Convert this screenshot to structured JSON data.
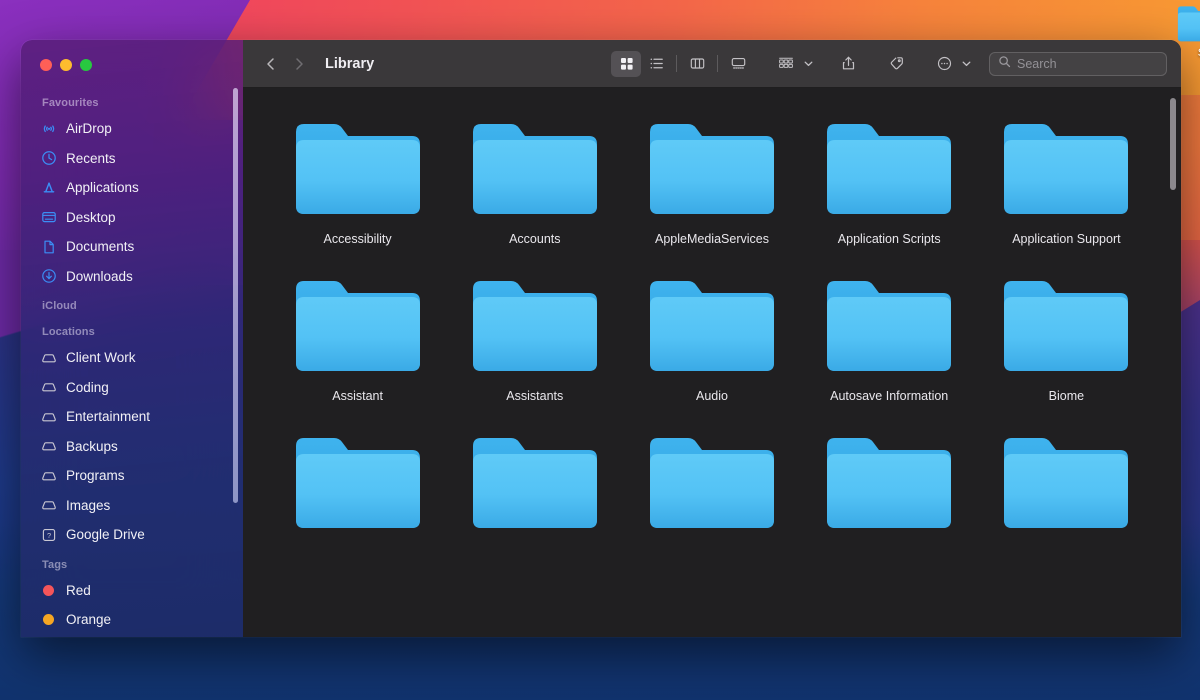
{
  "desktop": {
    "background_colors": {
      "purple": "#7d2bb0",
      "red": "#f0445f",
      "orange": "#f7873a",
      "blue": "#1e3a8a"
    },
    "items": [
      {
        "name": "Scr",
        "label": "Scr",
        "icon": "folder-icon"
      }
    ]
  },
  "window": {
    "title": "Library",
    "traffic_lights": {
      "close": "#ff5f57",
      "minimize": "#febc2e",
      "maximize": "#28c840"
    }
  },
  "toolbar": {
    "back_label": "‹",
    "forward_label": "›",
    "title": "Library",
    "view_modes": [
      {
        "name": "icon-view",
        "label": "Icon view",
        "active": true
      },
      {
        "name": "list-view",
        "label": "List view",
        "active": false
      },
      {
        "name": "column-view",
        "label": "Column view",
        "active": false
      },
      {
        "name": "gallery-view",
        "label": "Gallery view",
        "active": false
      }
    ],
    "group_label": "Group",
    "share_label": "Share",
    "tag_label": "Tags",
    "more_label": "More"
  },
  "search": {
    "placeholder": "Search",
    "value": ""
  },
  "sidebar": {
    "sections": [
      {
        "title": "Favourites",
        "items": [
          {
            "label": "AirDrop",
            "icon": "airdrop-icon"
          },
          {
            "label": "Recents",
            "icon": "clock-icon"
          },
          {
            "label": "Applications",
            "icon": "appstore-icon"
          },
          {
            "label": "Desktop",
            "icon": "desktop-icon"
          },
          {
            "label": "Documents",
            "icon": "document-icon"
          },
          {
            "label": "Downloads",
            "icon": "download-icon"
          }
        ]
      },
      {
        "title": "iCloud",
        "items": []
      },
      {
        "title": "Locations",
        "items": [
          {
            "label": "Client Work",
            "icon": "drive-icon"
          },
          {
            "label": "Coding",
            "icon": "drive-icon"
          },
          {
            "label": "Entertainment",
            "icon": "drive-icon"
          },
          {
            "label": "Backups",
            "icon": "drive-icon"
          },
          {
            "label": "Programs",
            "icon": "drive-icon"
          },
          {
            "label": "Images",
            "icon": "drive-icon"
          },
          {
            "label": "Google Drive",
            "icon": "unknown-volume-icon"
          }
        ]
      },
      {
        "title": "Tags",
        "items": [
          {
            "label": "Red",
            "icon": "tag-dot",
            "color": "#f4555a"
          },
          {
            "label": "Orange",
            "icon": "tag-dot",
            "color": "#f5a623"
          }
        ]
      }
    ]
  },
  "main": {
    "folders": [
      {
        "label": "Accessibility",
        "icon": "folder-icon"
      },
      {
        "label": "Accounts",
        "icon": "folder-icon"
      },
      {
        "label": "AppleMediaServices",
        "icon": "folder-icon"
      },
      {
        "label": "Application Scripts",
        "icon": "folder-icon"
      },
      {
        "label": "Application Support",
        "icon": "folder-icon"
      },
      {
        "label": "Assistant",
        "icon": "folder-icon"
      },
      {
        "label": "Assistants",
        "icon": "folder-icon"
      },
      {
        "label": "Audio",
        "icon": "folder-icon"
      },
      {
        "label": "Autosave Information",
        "icon": "folder-icon"
      },
      {
        "label": "Biome",
        "icon": "folder-icon"
      },
      {
        "label": "",
        "icon": "folder-icon"
      },
      {
        "label": "",
        "icon": "folder-icon"
      },
      {
        "label": "",
        "icon": "folder-icon"
      },
      {
        "label": "",
        "icon": "folder-icon"
      },
      {
        "label": "",
        "icon": "folder-icon"
      }
    ],
    "folder_color": "#4bb8f0"
  }
}
